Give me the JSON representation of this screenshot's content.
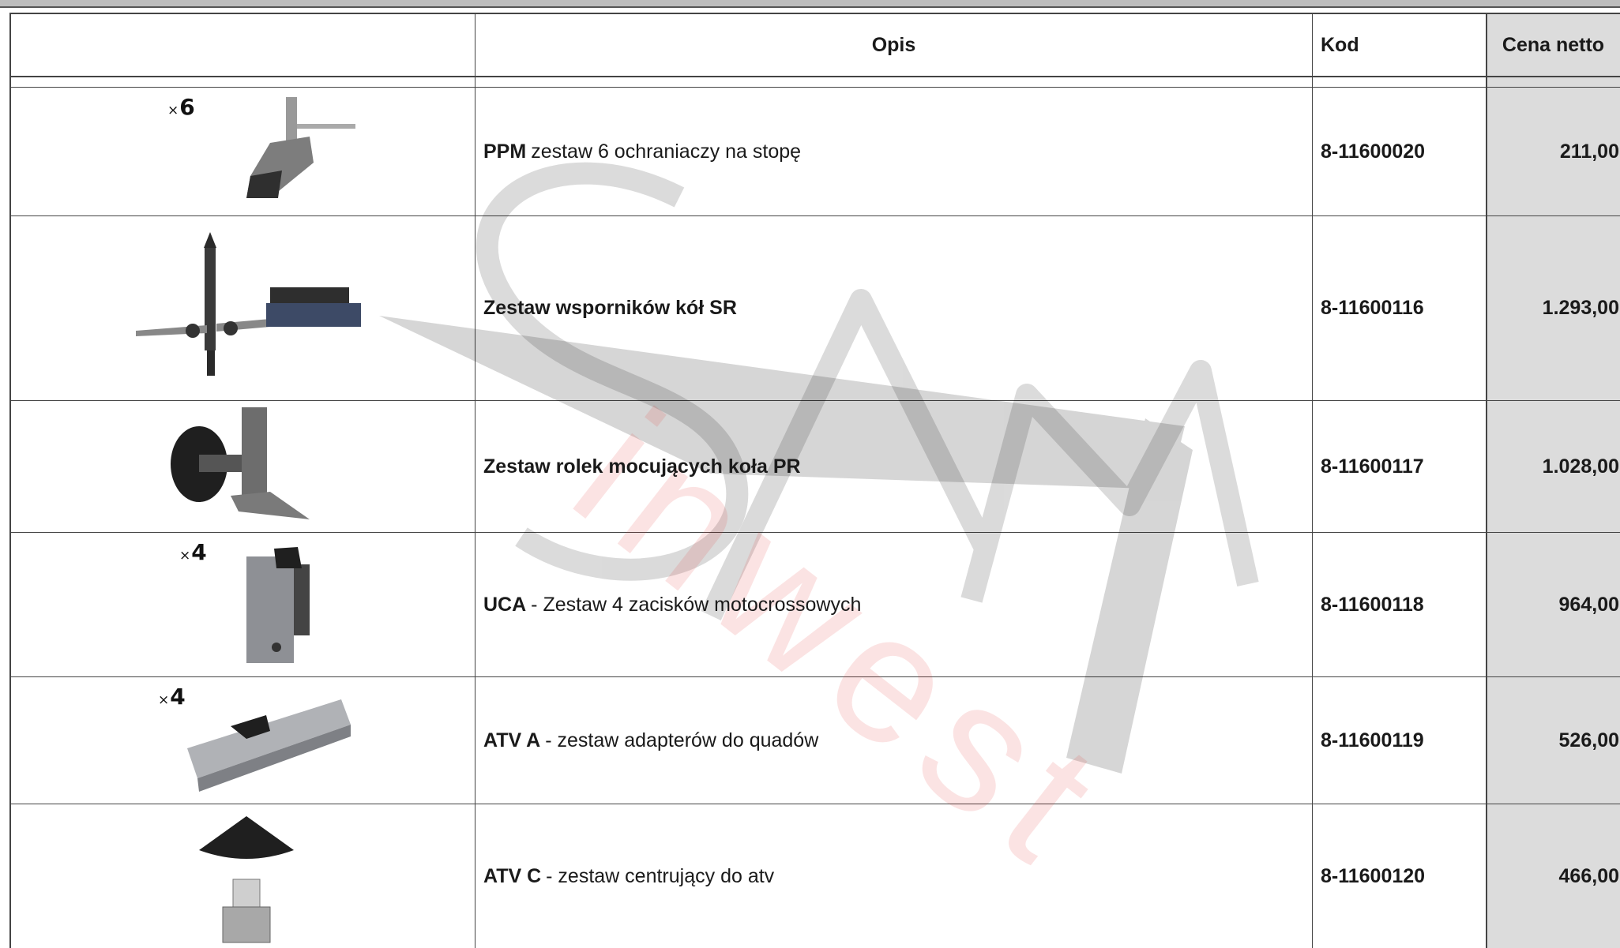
{
  "header": {
    "opis": "Opis",
    "kod": "Kod",
    "cena": "Cena netto"
  },
  "watermark": {
    "brand": "SAM",
    "sub": "inwest"
  },
  "rows": [
    {
      "qty": "6",
      "bold": "PPM",
      "text": "zestaw 6 ochraniaczy na stopę",
      "code": "8-11600020",
      "price": "211,00",
      "icon": "foot-protector-icon"
    },
    {
      "qty": "",
      "bold": "Zestaw wsporników kół SR",
      "text": "",
      "code": "8-11600116",
      "price": "1.293,00",
      "icon": "wheel-support-icon"
    },
    {
      "qty": "",
      "bold": "Zestaw rolek mocujących koła PR",
      "text": "",
      "code": "8-11600117",
      "price": "1.028,00",
      "icon": "roller-icon"
    },
    {
      "qty": "4",
      "bold": "UCA",
      "text": "- Zestaw 4 zacisków motocrossowych",
      "code": "8-11600118",
      "price": "964,00",
      "icon": "clamp-icon"
    },
    {
      "qty": "4",
      "bold": "ATV A",
      "text": "- zestaw adapterów do quadów",
      "code": "8-11600119",
      "price": "526,00",
      "icon": "adapter-icon"
    },
    {
      "qty": "",
      "bold": "ATV C",
      "text": "- zestaw centrujący do atv",
      "code": "8-11600120",
      "price": "466,00",
      "icon": "centering-cone-icon"
    }
  ]
}
